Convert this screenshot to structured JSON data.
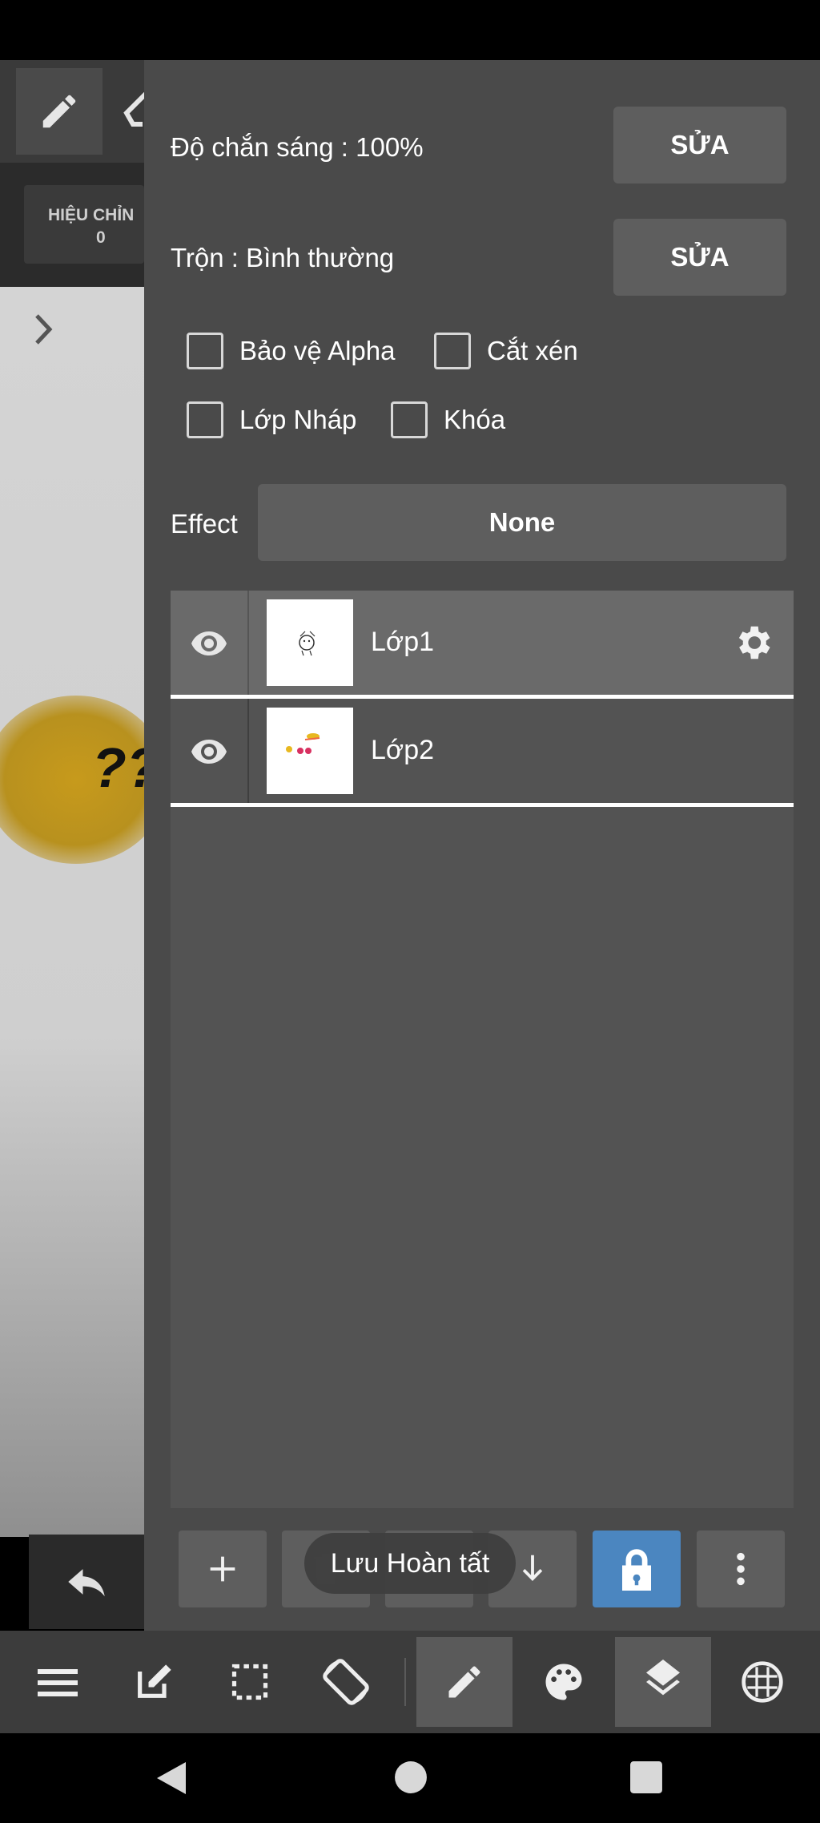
{
  "canvas": {
    "adjust_label": "HIỆU CHỈN",
    "adjust_value": "0",
    "blob_text": "??"
  },
  "layer_panel": {
    "opacity_label": "Độ chắn sáng : 100%",
    "opacity_edit": "SỬA",
    "blend_label": "Trộn : Bình thường",
    "blend_edit": "SỬA",
    "checkboxes": [
      {
        "label": "Bảo vệ Alpha",
        "checked": false
      },
      {
        "label": "Cắt xén",
        "checked": false
      },
      {
        "label": "Lớp Nháp",
        "checked": false
      },
      {
        "label": "Khóa",
        "checked": false
      }
    ],
    "effect_label": "Effect",
    "effect_value": "None",
    "layers": [
      {
        "name": "Lớp1",
        "visible": true,
        "selected": true
      },
      {
        "name": "Lớp2",
        "visible": true,
        "selected": false
      }
    ]
  },
  "toast": "Lưu Hoàn tất",
  "colors": {
    "panel_bg": "#4a4a4a",
    "lock_accent": "#4b86c0"
  },
  "icons": [
    "pen-icon",
    "eraser-icon",
    "chevron-right-icon",
    "undo-icon",
    "eye-icon",
    "gear-icon",
    "plus-icon",
    "trash-icon",
    "arrow-down-icon",
    "lock-icon",
    "more-vert-icon",
    "menu-icon",
    "edit-icon",
    "select-icon",
    "rotate-icon",
    "palette-icon",
    "layers-icon",
    "grid-icon",
    "back-icon",
    "home-icon",
    "recents-icon"
  ]
}
